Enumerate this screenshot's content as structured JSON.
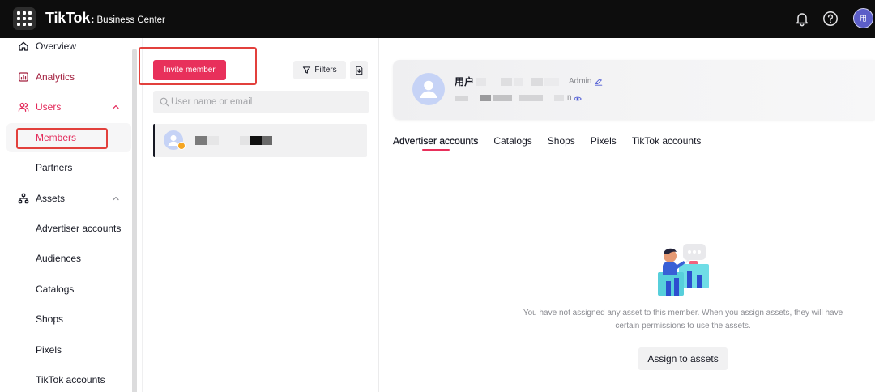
{
  "header": {
    "brand": "TikTok",
    "separator": ":",
    "product": "Business Center",
    "avatar_text": "用",
    "icons": [
      "grid-icon",
      "bell-icon",
      "help-icon"
    ]
  },
  "sidebar": {
    "items": [
      {
        "label": "Overview",
        "icon": "home-icon"
      },
      {
        "label": "Analytics",
        "icon": "analytics-icon"
      },
      {
        "label": "Users",
        "icon": "users-icon",
        "active": true,
        "expanded": true
      },
      {
        "label": "Members",
        "active": true,
        "selected": true
      },
      {
        "label": "Partners"
      },
      {
        "label": "Assets",
        "icon": "assets-icon",
        "expanded": true
      },
      {
        "label": "Advertiser accounts"
      },
      {
        "label": "Audiences"
      },
      {
        "label": "Catalogs"
      },
      {
        "label": "Shops"
      },
      {
        "label": "Pixels"
      },
      {
        "label": "TikTok accounts"
      }
    ]
  },
  "members_panel": {
    "invite_label": "Invite member",
    "filters_label": "Filters",
    "export_icon": "export-icon",
    "search_placeholder": "User name or email",
    "search_value": ""
  },
  "member_detail": {
    "name": "用户",
    "role": "Admin",
    "subtitle_fragment": "n",
    "tabs": [
      {
        "label": "Advertiser accounts",
        "active": true
      },
      {
        "label": "Catalogs"
      },
      {
        "label": "Shops"
      },
      {
        "label": "Pixels"
      },
      {
        "label": "TikTok accounts"
      }
    ],
    "empty_message": "You have not assigned any asset to this member. When you assign assets, they will have certain permissions to use the assets.",
    "assign_label": "Assign to assets"
  },
  "colors": {
    "accent": "#e8305b",
    "active_nav": "#e3295a",
    "topbar_bg": "#0d0d0d",
    "panel_gray": "#f1f1f2"
  }
}
